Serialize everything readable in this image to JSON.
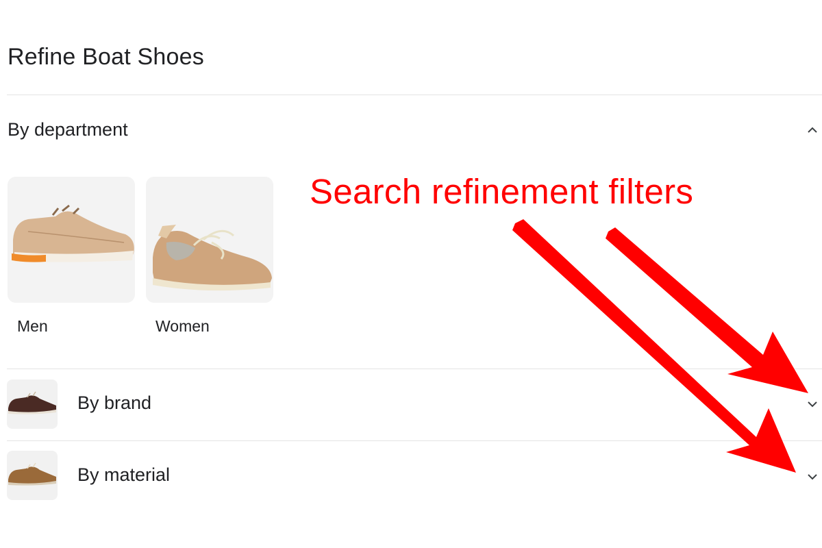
{
  "page": {
    "title": "Refine Boat Shoes"
  },
  "department": {
    "label": "By department",
    "expanded": true,
    "options": [
      {
        "label": "Men",
        "image": "tan-boat-shoe-men"
      },
      {
        "label": "Women",
        "image": "tan-boat-shoe-women"
      }
    ]
  },
  "brand": {
    "label": "By brand",
    "expanded": false,
    "image": "dark-brown-boat-shoe"
  },
  "material": {
    "label": "By material",
    "expanded": false,
    "image": "brown-leather-boat-shoe"
  },
  "annotation": {
    "text": "Search refinement filters",
    "color": "#ff0000"
  },
  "icons": {
    "expanded": "chevron-up-icon",
    "collapsed": "chevron-down-icon"
  }
}
